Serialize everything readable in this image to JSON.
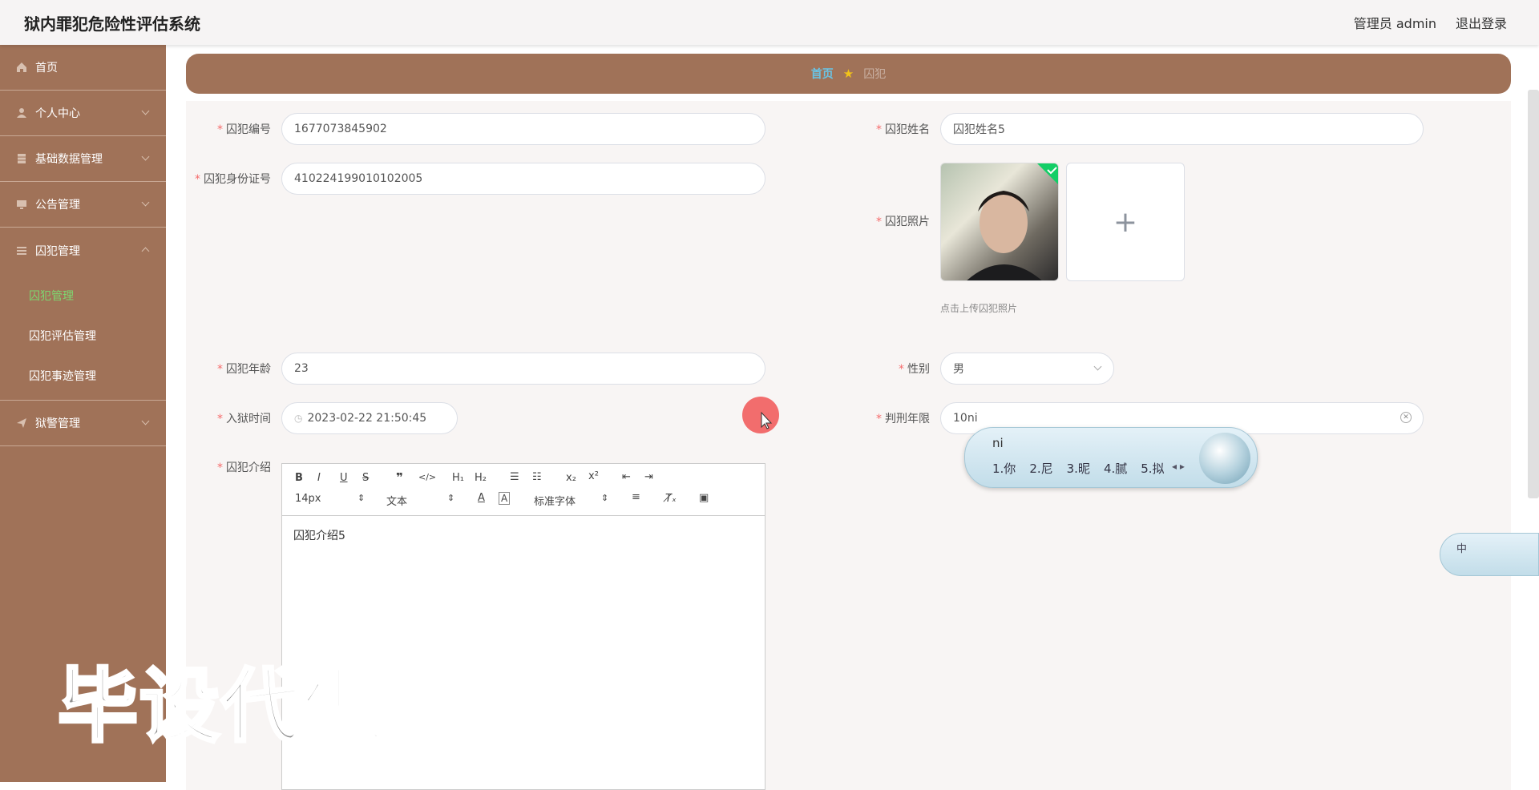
{
  "header": {
    "title": "狱内罪犯危险性评估系统",
    "admin_label": "管理员 admin",
    "logout_label": "退出登录"
  },
  "sidebar": {
    "items": [
      {
        "label": "首页",
        "icon": "home-icon"
      },
      {
        "label": "个人中心",
        "icon": "user-icon"
      },
      {
        "label": "基础数据管理",
        "icon": "database-icon"
      },
      {
        "label": "公告管理",
        "icon": "monitor-icon"
      },
      {
        "label": "囚犯管理",
        "icon": "list-icon"
      },
      {
        "label": "狱警管理",
        "icon": "send-icon"
      }
    ],
    "sub_items": [
      "囚犯管理",
      "囚犯评估管理",
      "囚犯事迹管理"
    ]
  },
  "breadcrumb": {
    "home": "首页",
    "current": "囚犯"
  },
  "form": {
    "prisoner_no": {
      "label": "囚犯编号",
      "value": "1677073845902"
    },
    "prisoner_name": {
      "label": "囚犯姓名",
      "value": "囚犯姓名5"
    },
    "id_card": {
      "label": "囚犯身份证号",
      "value": "410224199010102005"
    },
    "photo": {
      "label": "囚犯照片",
      "hint": "点击上传囚犯照片"
    },
    "age": {
      "label": "囚犯年龄",
      "value": "23"
    },
    "gender": {
      "label": "性别",
      "value": "男"
    },
    "entry_time": {
      "label": "入狱时间",
      "value": "2023-02-22 21:50:45"
    },
    "sentence": {
      "label": "判刑年限",
      "value": "10ni"
    },
    "intro": {
      "label": "囚犯介绍",
      "value": "囚犯介绍5"
    }
  },
  "editor": {
    "font_size": "14px",
    "paragraph": "文本",
    "font_family": "标准字体"
  },
  "ime": {
    "input": "ni",
    "candidates": [
      "1.你",
      "2.尼",
      "3.昵",
      "4.腻",
      "5.拟"
    ],
    "status": "中"
  },
  "watermark": "毕设代做"
}
